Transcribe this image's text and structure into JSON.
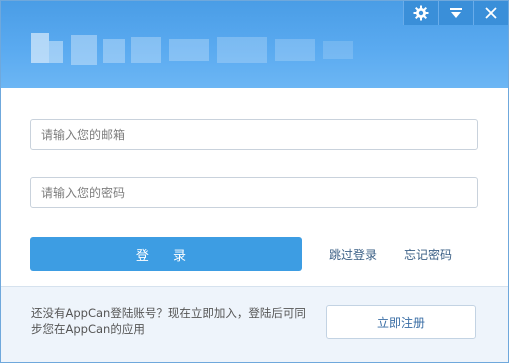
{
  "window": {
    "controls": [
      {
        "name": "settings",
        "icon": "gear-icon"
      },
      {
        "name": "menu",
        "icon": "dropdown-icon"
      },
      {
        "name": "close",
        "icon": "close-icon"
      }
    ]
  },
  "form": {
    "email_placeholder": "请输入您的邮箱",
    "password_placeholder": "请输入您的密码",
    "login_label": "登 录",
    "skip_label": "跳过登录",
    "forgot_label": "忘记密码"
  },
  "footer": {
    "description": "还没有AppCan登陆账号？现在立即加入，登陆后可同步您在AppCan的应用",
    "register_label": "立即注册"
  },
  "colors": {
    "header": "#4a9de6",
    "primary_button": "#3d9de3",
    "footer_bg": "#eef4fb"
  }
}
